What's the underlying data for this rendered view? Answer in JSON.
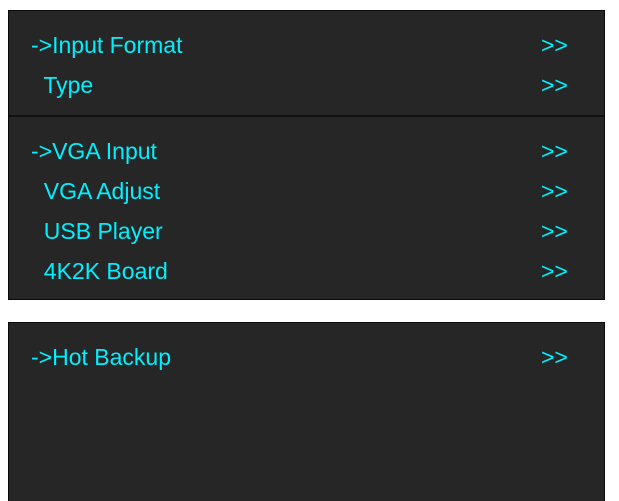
{
  "menu_group_1": {
    "items": [
      {
        "label": "->Input Format",
        "arrow": ">>"
      },
      {
        "label": "  Type",
        "arrow": ">>"
      }
    ]
  },
  "menu_group_2": {
    "items": [
      {
        "label": "->VGA Input",
        "arrow": ">>"
      },
      {
        "label": "  VGA Adjust",
        "arrow": ">>"
      },
      {
        "label": "  USB Player",
        "arrow": ">>"
      },
      {
        "label": "  4K2K Board",
        "arrow": ">>"
      }
    ]
  },
  "menu_group_3": {
    "items": [
      {
        "label": "->Hot Backup",
        "arrow": ">>"
      }
    ]
  },
  "colors": {
    "panel_background": "#262626",
    "text": "#00f0ff",
    "page_background": "#ffffff"
  }
}
